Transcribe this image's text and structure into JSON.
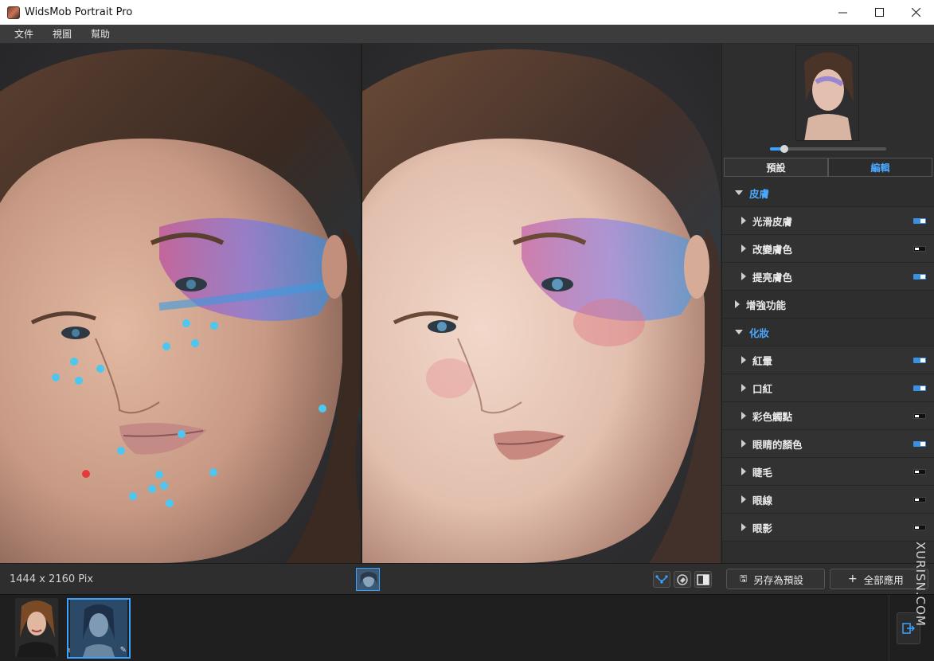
{
  "window": {
    "title": "WidsMob Portrait Pro",
    "controls": {
      "minimize": "minimize-icon",
      "maximize": "maximize-icon",
      "close": "close-icon"
    }
  },
  "menu": {
    "items": [
      "文件",
      "視圖",
      "幫助"
    ]
  },
  "viewer": {
    "left_pane": "before",
    "right_pane": "after"
  },
  "sidebar": {
    "zoom_level": 0.12,
    "tabs": [
      {
        "label": "預設",
        "active": false
      },
      {
        "label": "編輯",
        "active": true
      }
    ],
    "sections": [
      {
        "label": "皮膚",
        "expanded": true,
        "items": [
          {
            "label": "光滑皮膚",
            "enabled": true
          },
          {
            "label": "改變膚色",
            "enabled": false
          },
          {
            "label": "提亮膚色",
            "enabled": true
          }
        ]
      },
      {
        "label": "增強功能",
        "expanded": false,
        "items": []
      },
      {
        "label": "化妝",
        "expanded": true,
        "items": [
          {
            "label": "紅暈",
            "enabled": true
          },
          {
            "label": "口紅",
            "enabled": true
          },
          {
            "label": "彩色觸點",
            "enabled": false
          },
          {
            "label": "眼睛的顏色",
            "enabled": true
          },
          {
            "label": "睫毛",
            "enabled": false
          },
          {
            "label": "眼線",
            "enabled": false
          },
          {
            "label": "眼影",
            "enabled": false
          }
        ]
      }
    ]
  },
  "status": {
    "dimensions": "1444 x 2160 Pix",
    "tools": [
      "face-points-icon",
      "eraser-icon",
      "compare-icon"
    ]
  },
  "actions": {
    "save_preset": "另存為預設",
    "apply_all": "全部應用"
  },
  "filmstrip": {
    "items": [
      "photo-1",
      "photo-2"
    ],
    "selected": 1
  },
  "watermark": "XURISN.COM",
  "colors": {
    "accent": "#3aa3ff",
    "landmark": "#4cc7ef",
    "landmark_active": "#e8383a"
  }
}
